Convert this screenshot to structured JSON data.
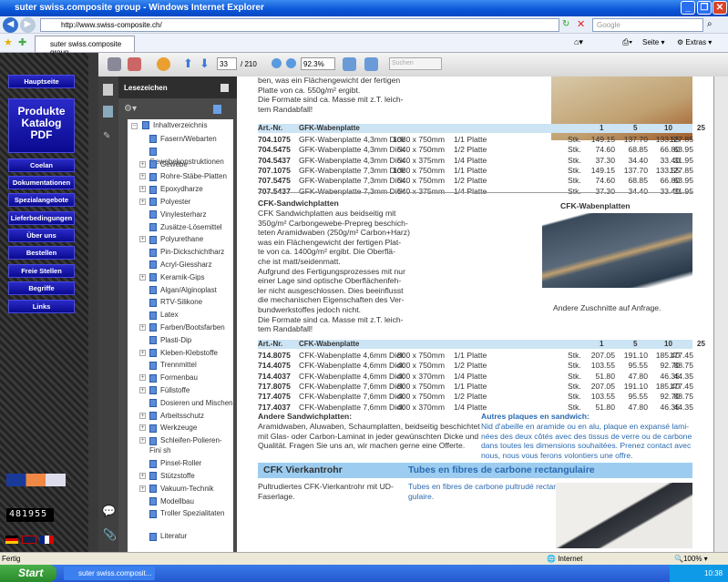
{
  "window": {
    "title": "suter swiss.composite group - Windows Internet Explorer"
  },
  "address": {
    "url": "http://www.swiss-composite.ch/",
    "search_placeholder": "Google"
  },
  "tab": {
    "label": "suter swiss.composite group"
  },
  "commandbar": {
    "page_label": "Seite",
    "extras_label": "Extras"
  },
  "sitenav": {
    "items": [
      "Hauptseite",
      "Coelan",
      "Dokumentationen",
      "Spezialangebote",
      "Lieferbedingungen",
      "Über uns",
      "Bestellen",
      "Freie Stellen",
      "Begriffe",
      "Links"
    ],
    "big_button": [
      "Produkte",
      "Katalog",
      "PDF"
    ],
    "counter": "481955"
  },
  "acrobat": {
    "page": "33",
    "total": "/ 210",
    "zoom": "92.3%",
    "search_placeholder": "Suchen"
  },
  "bookmarks": {
    "title": "Lesezeichen",
    "root": "Inhaltverzeichnis",
    "items": [
      {
        "label": "Fasern/Webarten",
        "exp": false
      },
      {
        "label": "Gewebekonstruktionen",
        "exp": false
      },
      {
        "label": "Gewebe",
        "exp": true
      },
      {
        "label": "Rohre-Stäbe-Platten",
        "exp": true
      },
      {
        "label": "Epoxydharze",
        "exp": true
      },
      {
        "label": "Polyester",
        "exp": true
      },
      {
        "label": "Vinylesterharz",
        "exp": false
      },
      {
        "label": "Zusätze-Lösemittel",
        "exp": false
      },
      {
        "label": "Polyurethane",
        "exp": true
      },
      {
        "label": "Pin-Dickschichtharz",
        "exp": false
      },
      {
        "label": "Acryl-Giessharz",
        "exp": false
      },
      {
        "label": "Keramik-Gips",
        "exp": true
      },
      {
        "label": "Algan/Alginoplast",
        "exp": false
      },
      {
        "label": "RTV-Silikone",
        "exp": false
      },
      {
        "label": "Latex",
        "exp": false
      },
      {
        "label": "Farben/Bootsfarben",
        "exp": true
      },
      {
        "label": "Plasti-Dip",
        "exp": false
      },
      {
        "label": "Kleben-Klebstoffe",
        "exp": true
      },
      {
        "label": "Trennmittel",
        "exp": false
      },
      {
        "label": "Formenbau",
        "exp": true
      },
      {
        "label": "Füllstoffe",
        "exp": true
      },
      {
        "label": "Dosieren und Mischen",
        "exp": false
      },
      {
        "label": "Arbeitsschutz",
        "exp": true
      },
      {
        "label": "Werkzeuge",
        "exp": true
      },
      {
        "label": "Schleifen-Polieren-Fini sh",
        "exp": true
      },
      {
        "label": "Pinsel-Roller",
        "exp": false
      },
      {
        "label": "Stützstoffe",
        "exp": true
      },
      {
        "label": "Vakuum-Technik",
        "exp": true
      },
      {
        "label": "Modellbau",
        "exp": false
      },
      {
        "label": "Troller Spezialitaten",
        "exp": false
      },
      {
        "label": "Literatur",
        "exp": false
      }
    ]
  },
  "pdf": {
    "intro": [
      "ben, was ein Flächengewicht der fertigen",
      "Platte von ca. 550g/m² ergibt.",
      "Die Formate sind ca. Masse mit z.T. leich-",
      "tem Randabfall!"
    ],
    "table1": {
      "header": [
        "Art.-Nr.",
        "GFK-Wabenplatte",
        "1",
        "5",
        "10",
        "25"
      ],
      "rows": [
        [
          "704.1075",
          "GFK-Wabenplatte 4,3mm Dick",
          "1080 x 750mm",
          "1/1 Platte",
          "Stk.",
          "149.15",
          "137.70",
          "133.55",
          "127.85"
        ],
        [
          "704.5475",
          "GFK-Wabenplatte 4,3mm Dick",
          "540 x 750mm",
          "1/2 Platte",
          "Stk.",
          "74.60",
          "68.85",
          "66.80",
          "63.95"
        ],
        [
          "704.5437",
          "GFK-Wabenplatte 4,3mm Dick",
          "540 x 375mm",
          "1/4 Platte",
          "Stk.",
          "37.30",
          "34.40",
          "33.40",
          "31.95"
        ],
        [
          "707.1075",
          "GFK-Wabenplatte 7,3mm Dick",
          "1080 x 750mm",
          "1/1 Platte",
          "Stk.",
          "149.15",
          "137.70",
          "133.55",
          "127.85"
        ],
        [
          "707.5475",
          "GFK-Wabenplatte 7,3mm Dick",
          "540 x 750mm",
          "1/2 Platte",
          "Stk.",
          "74.60",
          "68.85",
          "66.80",
          "63.95"
        ],
        [
          "707.5437",
          "GFK-Wabenplatte 7,3mm Dick",
          "540 x 375mm",
          "1/4 Platte",
          "Stk.",
          "37.30",
          "34.40",
          "33.40",
          "31.95"
        ]
      ]
    },
    "cfk": {
      "title": "CFK-Sandwichplatten",
      "text": [
        "CFK Sandwichplatten aus beidseitig mit",
        "350g/m² Carbongewebe-Prepreg beschich-",
        "teten Aramidwaben (250g/m² Carbon+Harz)",
        "was ein Flächengewicht der fertigen Plat-",
        "te von ca. 1400g/m² ergibt. Die Oberflä-",
        "che ist matt/seidenmatt.",
        "Aufgrund des Fertigungsprozesses mit nur",
        "einer Lage sind optische Oberflächenfeh-",
        "ler nicht ausgeschlossen. Dies beeinflusst",
        "die mechanischen Eigenschaften des Ver-",
        "bundwerkstoffes jedoch nicht.",
        "Die Formate sind ca. Masse mit z.T. leich-",
        "tem Randabfall!"
      ],
      "image_title": "CFK-Wabenplatten",
      "image_caption": "Andere Zuschnitte auf Anfrage."
    },
    "table2": {
      "header": [
        "Art.-Nr.",
        "CFK-Wabenplatte",
        "1",
        "5",
        "10",
        "25"
      ],
      "rows": [
        [
          "714.8075",
          "CFK-Wabenplatte 4,6mm Dick",
          "800 x 750mm",
          "1/1 Platte",
          "Stk.",
          "207.05",
          "191.10",
          "185.40",
          "177.45"
        ],
        [
          "714.4075",
          "CFK-Wabenplatte 4,6mm Dick",
          "400 x 750mm",
          "1/2 Platte",
          "Stk.",
          "103.55",
          "95.55",
          "92.70",
          "88.75"
        ],
        [
          "714.4037",
          "CFK-Wabenplatte 4,6mm Dick",
          "400 x 370mm",
          "1/4 Platte",
          "Stk.",
          "51.80",
          "47.80",
          "46.35",
          "44.35"
        ],
        [
          "717.8075",
          "CFK-Wabenplatte 7,6mm Dick",
          "800 x 750mm",
          "1/1 Platte",
          "Stk.",
          "207.05",
          "191.10",
          "185.40",
          "177.45"
        ],
        [
          "717.4075",
          "CFK-Wabenplatte 7,6mm Dick",
          "400 x 750mm",
          "1/2 Platte",
          "Stk.",
          "103.55",
          "95.55",
          "92.70",
          "88.75"
        ],
        [
          "717.4037",
          "CFK-Wabenplatte 7,6mm Dick",
          "400 x 370mm",
          "1/4 Platte",
          "Stk.",
          "51.80",
          "47.80",
          "46.35",
          "44.35"
        ]
      ]
    },
    "andere": {
      "title": "Andere Sandwichplatten:",
      "text": [
        "Aramidwaben, Aluwaben, Schaumplatten, beidseitig beschichtet",
        "mit Glas- oder Carbon-Laminat in jeder gewünschten Dicke und",
        "Qualität. Fragen Sie uns an, wir machen gerne eine Offerte."
      ]
    },
    "autres": {
      "title": "Autres plaques en sandwich:",
      "text": [
        "Nid d'abeille en aramide ou en alu, plaque en expansé lami-",
        "nées des deux côtés avec des tissus de verre ou de carbone",
        "dans toutes les dimensions souhaitées. Prenez contact avec",
        "nous, nous vous ferons volontiers une offre."
      ]
    },
    "vierkant": {
      "title_de": "CFK Vierkantrohr",
      "title_fr": "Tubes en fibres de carbone rectangulaire",
      "text_de": [
        "Pultrudiertes CFK-Vierkantrohr mit UD-",
        "Faserlage."
      ],
      "text_fr": [
        "Tubes en fibres de carbone pultrudé rectan-",
        "gulaire."
      ]
    }
  },
  "status": {
    "text": "Fertig",
    "zone": "Internet",
    "zoom": "100%"
  },
  "taskbar": {
    "start": "Start",
    "task": "suter swiss.composit...",
    "clock": "10:38"
  }
}
